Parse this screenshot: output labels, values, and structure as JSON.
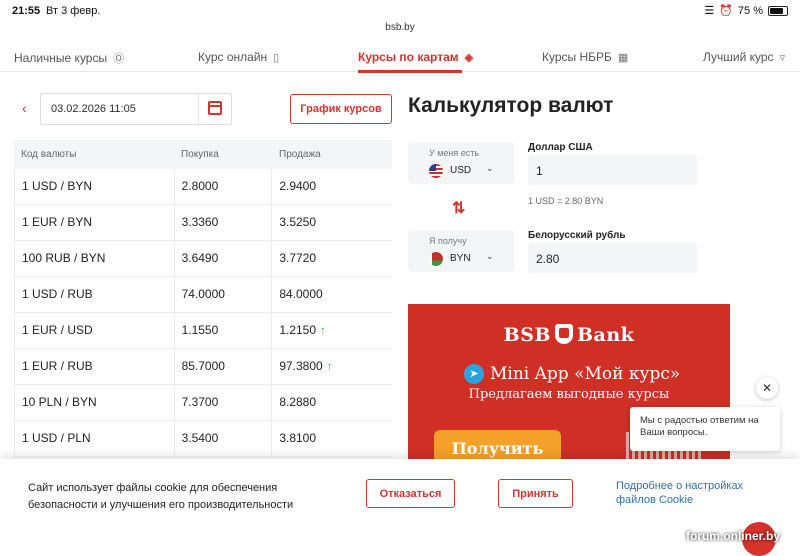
{
  "status": {
    "time": "21:55",
    "date": "Вт 3 февр.",
    "battery": "75 %"
  },
  "browser": {
    "url": "bsb.by"
  },
  "tabs": [
    {
      "label": "Наличные курсы",
      "icon": "dollar-icon"
    },
    {
      "label": "Курс онлайн",
      "icon": "phone-icon"
    },
    {
      "label": "Курсы по картам",
      "icon": "card-icon"
    },
    {
      "label": "Курсы НБРБ",
      "icon": "building-icon"
    },
    {
      "label": "Лучший курс",
      "icon": "chevron-down-icon"
    }
  ],
  "date_picker": {
    "value": "03.02.2026 11:05"
  },
  "chart_button": "График курсов",
  "table": {
    "headers": [
      "Код валюты",
      "Покупка",
      "Продажа"
    ],
    "rows": [
      {
        "pair": "1 USD / BYN",
        "buy": "2.8000",
        "sell": "2.9400",
        "up": false
      },
      {
        "pair": "1 EUR / BYN",
        "buy": "3.3360",
        "sell": "3.5250",
        "up": false
      },
      {
        "pair": "100 RUB / BYN",
        "buy": "3.6490",
        "sell": "3.7720",
        "up": false
      },
      {
        "pair": "1 USD / RUB",
        "buy": "74.0000",
        "sell": "84.0000",
        "up": false
      },
      {
        "pair": "1 EUR / USD",
        "buy": "1.1550",
        "sell": "1.2150",
        "up": true
      },
      {
        "pair": "1 EUR / RUB",
        "buy": "85.7000",
        "sell": "97.3800",
        "up": true
      },
      {
        "pair": "10 PLN / BYN",
        "buy": "7.3700",
        "sell": "8.2880",
        "up": false
      },
      {
        "pair": "1 USD / PLN",
        "buy": "3.5400",
        "sell": "3.8100",
        "up": false
      }
    ],
    "up_arrow": "↑"
  },
  "calculator": {
    "title": "Калькулятор валют",
    "have_label": "У меня есть",
    "have_code": "USD",
    "have_name": "Доллар США",
    "have_amount": "1",
    "rate_note": "1 USD = 2.80 BYN",
    "get_label": "Я получу",
    "get_code": "BYN",
    "get_name": "Белорусский рубль",
    "get_amount": "2.80"
  },
  "banner": {
    "brand_left": "BSB",
    "brand_right": "Bank",
    "mini_app": "Mini App «Мой курс»",
    "subtitle": "Предлагаем выгодные курсы",
    "cta": "Получить"
  },
  "chat": {
    "message": "Мы с радостью ответим на Ваши вопросы."
  },
  "cookie": {
    "text": "Сайт использует файлы cookie для обеспечения безопасности и улучшения его производительности",
    "refuse": "Отказаться",
    "accept": "Принять",
    "settings_link": "Подробнее о настройках файлов Cookie"
  },
  "watermark": "forum.onliner.by",
  "colors": {
    "accent": "#d5332b",
    "up": "#2eab5d",
    "link": "#2d6fb4"
  }
}
